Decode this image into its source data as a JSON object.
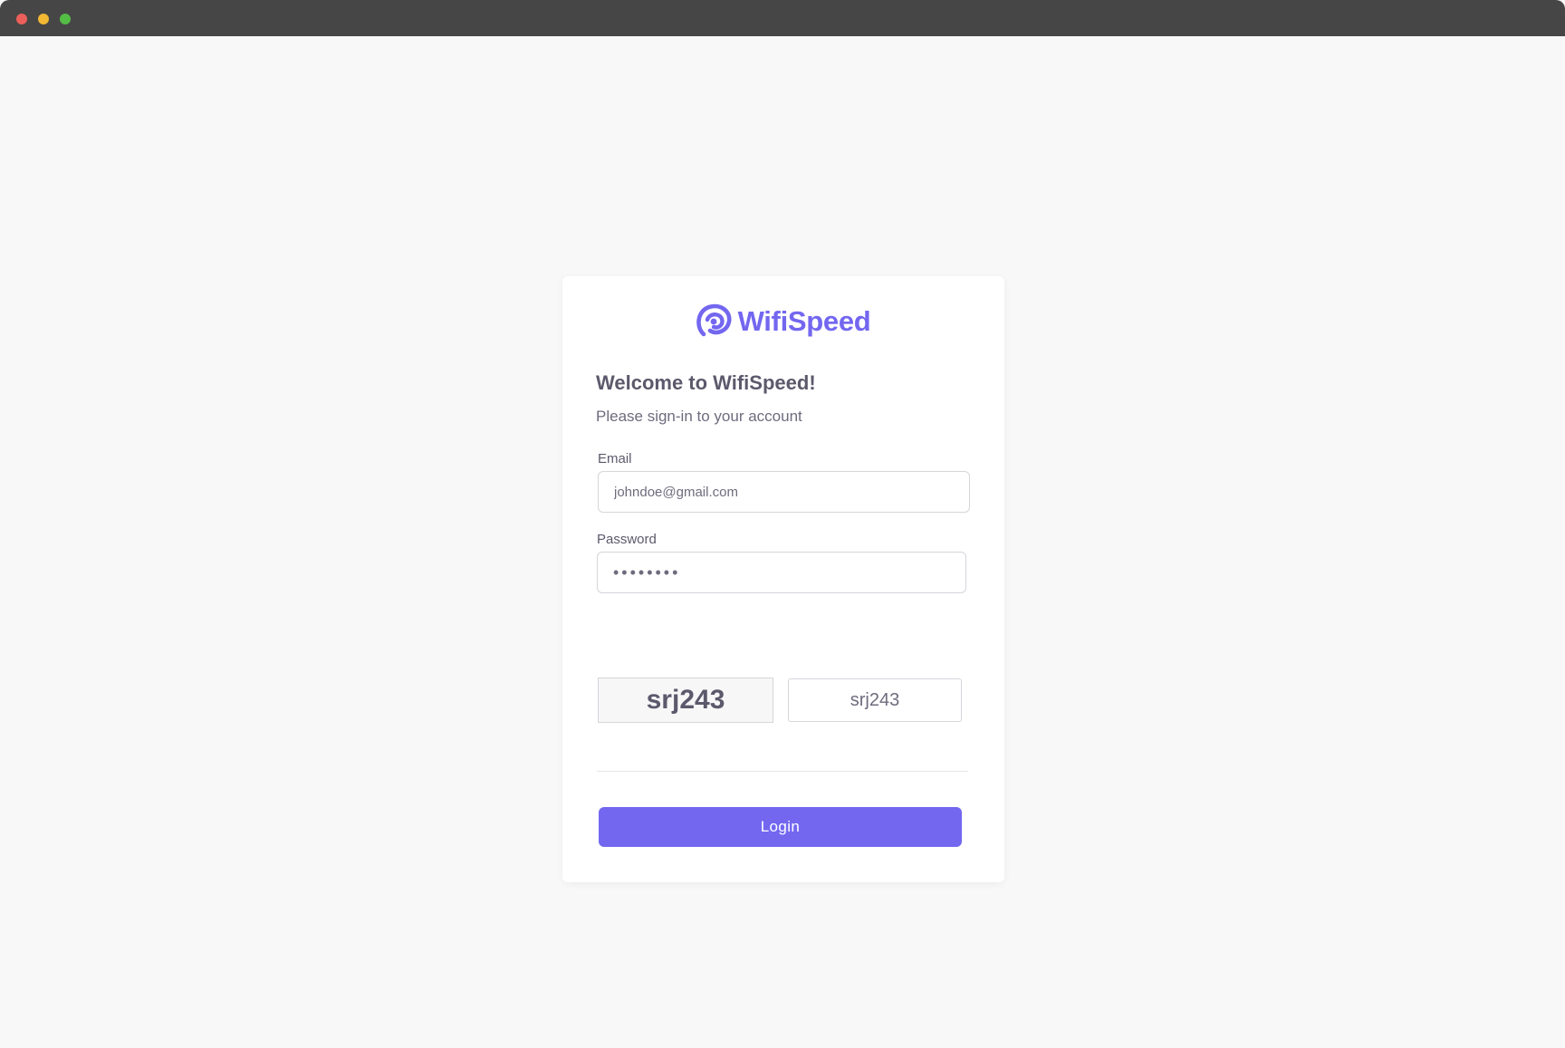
{
  "window": {
    "controls": [
      "close",
      "minimize",
      "maximize"
    ]
  },
  "brand": {
    "name": "WifiSpeed",
    "logo_icon": "wifi-spiral-logo-icon",
    "color": "#7367f0"
  },
  "heading": {
    "title": "Welcome to WifiSpeed!",
    "subtitle": "Please sign-in to your account"
  },
  "form": {
    "email": {
      "label": "Email",
      "value": "johndoe@gmail.com",
      "placeholder": ""
    },
    "password": {
      "label": "Password",
      "value": "••••••••",
      "placeholder": ""
    },
    "captcha": {
      "code": "srj243",
      "input_value": "srj243"
    },
    "login_label": "Login"
  },
  "colors": {
    "primary": "#7367f0",
    "heading_text": "#5d596c",
    "body_text": "#6f6b7d",
    "background": "#f8f8f8"
  }
}
